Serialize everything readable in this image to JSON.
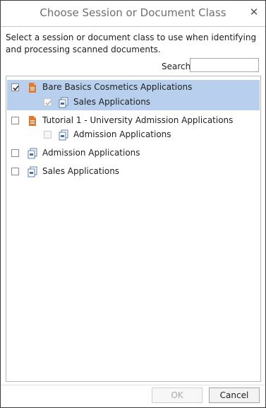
{
  "dialog": {
    "title": "Choose Session or Document Class",
    "close_label": "✕",
    "instructions": "Select a session or document class to use when identifying and processing scanned documents.",
    "search_label": "Search",
    "search_value": "",
    "items": [
      {
        "label": "Bare Basics Cosmetics Applications",
        "type": "session",
        "checked": true,
        "selected": true
      },
      {
        "label": "Sales Applications",
        "type": "document-class",
        "checked": true,
        "disabled": true
      },
      {
        "label": "Tutorial 1 - University Admission Applications",
        "type": "session",
        "checked": false
      },
      {
        "label": "Admission Applications",
        "type": "document-class",
        "checked": false,
        "disabled": true
      },
      {
        "label": "Admission Applications",
        "type": "document-class",
        "checked": false
      },
      {
        "label": "Sales Applications",
        "type": "document-class",
        "checked": false
      }
    ],
    "ok_label": "OK",
    "cancel_label": "Cancel"
  }
}
